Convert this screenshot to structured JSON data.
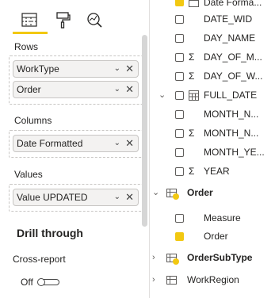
{
  "fields_pane": {
    "tabs": [
      "build-visual",
      "format-visual",
      "analytics"
    ],
    "sections": {
      "rows": {
        "label": "Rows",
        "items": [
          "WorkType",
          "Order"
        ]
      },
      "columns": {
        "label": "Columns",
        "items": [
          "Date Formatted"
        ]
      },
      "values": {
        "label": "Values",
        "items": [
          "Value UPDATED"
        ]
      }
    },
    "drill_through": {
      "title": "Drill through",
      "cross_report_label": "Cross-report",
      "toggle_state": "Off"
    }
  },
  "field_list": {
    "date_fields": [
      {
        "label": "Date Forma...",
        "checked": true,
        "icon": "calendar-icon"
      },
      {
        "label": "DATE_WID",
        "checked": false,
        "icon": ""
      },
      {
        "label": "DAY_NAME",
        "checked": false,
        "icon": ""
      },
      {
        "label": "DAY_OF_M...",
        "checked": false,
        "icon": "sigma-icon"
      },
      {
        "label": "DAY_OF_W...",
        "checked": false,
        "icon": "sigma-icon"
      },
      {
        "label": "FULL_DATE",
        "checked": false,
        "icon": "calendar-icon"
      },
      {
        "label": "MONTH_N...",
        "checked": false,
        "icon": ""
      },
      {
        "label": "MONTH_N...",
        "checked": false,
        "icon": "sigma-icon"
      },
      {
        "label": "MONTH_YE...",
        "checked": false,
        "icon": ""
      },
      {
        "label": "YEAR",
        "checked": false,
        "icon": "sigma-icon"
      }
    ],
    "tables": [
      {
        "label": "Order",
        "expanded": true,
        "has_selection": true,
        "fields": [
          {
            "label": "Measure",
            "checked": false
          },
          {
            "label": "Order",
            "checked": true
          }
        ]
      },
      {
        "label": "OrderSubType",
        "expanded": false,
        "has_selection": true
      },
      {
        "label": "WorkRegion",
        "expanded": false,
        "has_selection": false
      }
    ]
  },
  "colors": {
    "accent": "#f2c811",
    "border": "#c8c6c4",
    "pill_bg": "#f3f2f1"
  }
}
